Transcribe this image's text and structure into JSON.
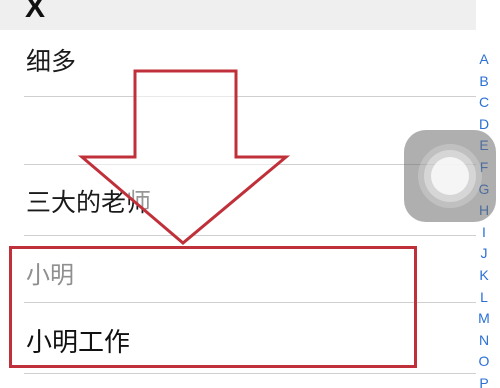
{
  "section": {
    "letter": "X"
  },
  "contacts": [
    {
      "name": "细多"
    },
    {
      "name": ""
    },
    {
      "name": ""
    },
    {
      "name": "三大的老师"
    },
    {
      "name": "小明"
    },
    {
      "name": "小明工作"
    }
  ],
  "index_letters": [
    "A",
    "B",
    "C",
    "D",
    "E",
    "F",
    "G",
    "H",
    "I",
    "J",
    "K",
    "L",
    "M",
    "N",
    "O",
    "P"
  ],
  "colors": {
    "annotation_red": "#c0303a",
    "index_blue": "#2a6fd6",
    "header_gray": "#efefef"
  },
  "icons": {
    "assistive_touch": "assistive-touch-icon",
    "annotation_arrow": "down-arrow-annotation-icon"
  }
}
